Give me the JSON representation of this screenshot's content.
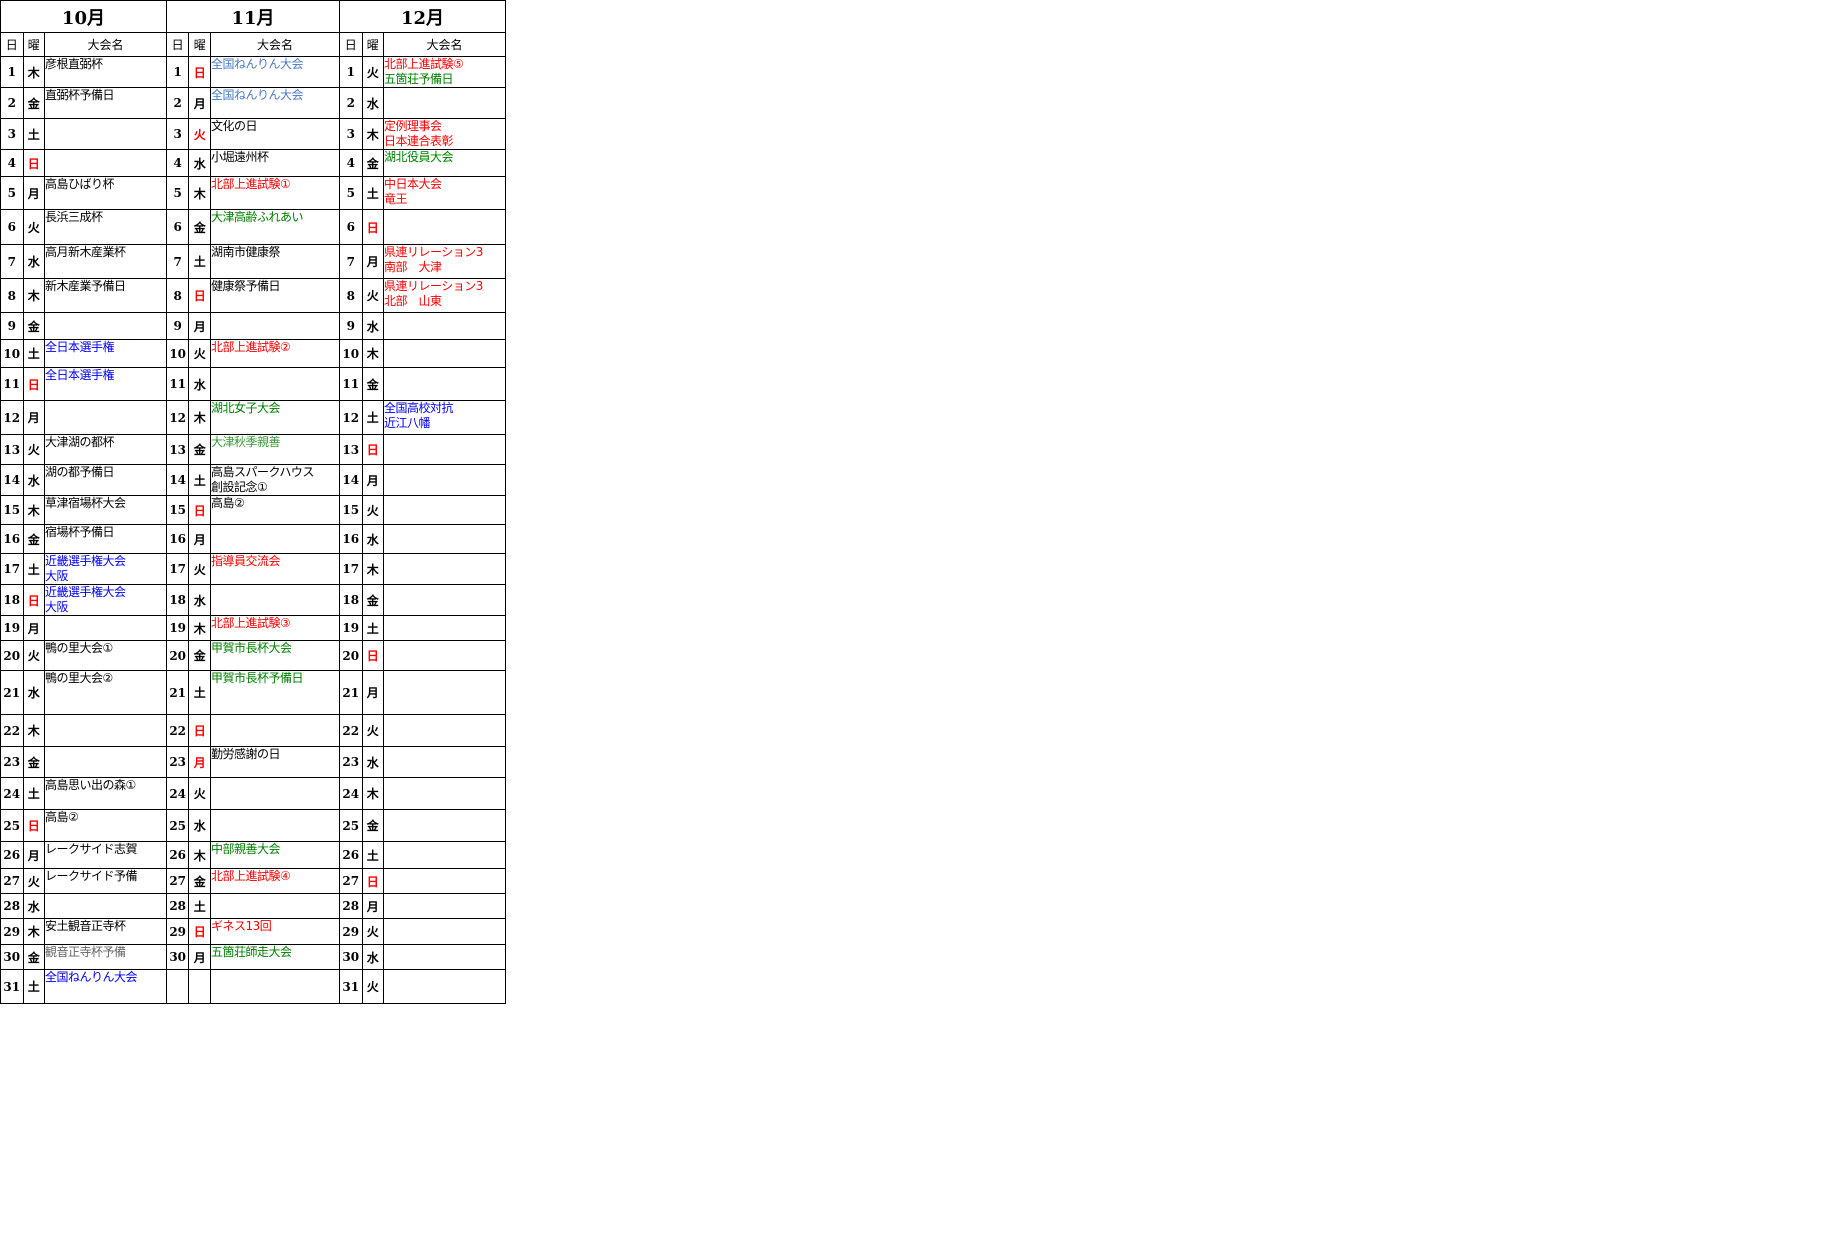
{
  "months": [
    "10月",
    "11月",
    "12月"
  ],
  "col_headers": {
    "day": "日",
    "weekday": "曜",
    "event": "大会名"
  },
  "colors": {
    "black": "#000000",
    "red": "#ff0000",
    "blue": "#0000ff",
    "green": "#008000",
    "lightblue": "#4a7cc4",
    "gray": "#666666",
    "lightgreen": "#3a9a3a"
  },
  "rows": [
    {
      "d": "1",
      "m": [
        {
          "w": "木",
          "wc": "black",
          "e": [
            "彦根直弼杯"
          ],
          "c": "black"
        },
        {
          "w": "日",
          "wc": "red",
          "e": [
            "全国ねんりん大会"
          ],
          "c": "lightblue"
        },
        {
          "w": "火",
          "wc": "black",
          "e": [
            "北部上進試験⑤",
            "五箇荘予備日"
          ],
          "c": [
            "red",
            "green"
          ]
        }
      ]
    },
    {
      "d": "2",
      "m": [
        {
          "w": "金",
          "wc": "black",
          "e": [
            "直弼杯予備日"
          ],
          "c": "black"
        },
        {
          "w": "月",
          "wc": "black",
          "e": [
            "全国ねんりん大会"
          ],
          "c": "lightblue"
        },
        {
          "w": "水",
          "wc": "black",
          "e": [],
          "c": "black"
        }
      ]
    },
    {
      "d": "3",
      "m": [
        {
          "w": "土",
          "wc": "black",
          "e": [],
          "c": "black"
        },
        {
          "w": "火",
          "wc": "red",
          "e": [
            "文化の日"
          ],
          "c": "black"
        },
        {
          "w": "木",
          "wc": "black",
          "e": [
            "定例理事会",
            "日本連合表彰"
          ],
          "c": "red"
        }
      ]
    },
    {
      "d": "4",
      "m": [
        {
          "w": "日",
          "wc": "red",
          "e": [],
          "c": "black"
        },
        {
          "w": "水",
          "wc": "black",
          "e": [
            "小堀遠州杯"
          ],
          "c": "black"
        },
        {
          "w": "金",
          "wc": "black",
          "e": [
            "湖北役員大会"
          ],
          "c": "green"
        }
      ]
    },
    {
      "d": "5",
      "m": [
        {
          "w": "月",
          "wc": "black",
          "e": [
            "高島ひばり杯"
          ],
          "c": "black"
        },
        {
          "w": "木",
          "wc": "black",
          "e": [
            "北部上進試験①"
          ],
          "c": "red"
        },
        {
          "w": "土",
          "wc": "black",
          "e": [
            "中日本大会",
            "竜王"
          ],
          "c": "red"
        }
      ]
    },
    {
      "d": "6",
      "m": [
        {
          "w": "火",
          "wc": "black",
          "e": [
            "長浜三成杯"
          ],
          "c": "black"
        },
        {
          "w": "金",
          "wc": "black",
          "e": [
            "大津高齢ふれあい"
          ],
          "c": "green"
        },
        {
          "w": "日",
          "wc": "red",
          "e": [],
          "c": "black"
        }
      ]
    },
    {
      "d": "7",
      "m": [
        {
          "w": "水",
          "wc": "black",
          "e": [
            "高月新木産業杯"
          ],
          "c": "black"
        },
        {
          "w": "土",
          "wc": "black",
          "e": [
            "湖南市健康祭"
          ],
          "c": "black"
        },
        {
          "w": "月",
          "wc": "black",
          "e": [
            "県連リレーション3",
            "南部　大津"
          ],
          "c": "red"
        }
      ]
    },
    {
      "d": "8",
      "m": [
        {
          "w": "木",
          "wc": "black",
          "e": [
            "新木産業予備日"
          ],
          "c": "black"
        },
        {
          "w": "日",
          "wc": "red",
          "e": [
            "健康祭予備日"
          ],
          "c": "black"
        },
        {
          "w": "火",
          "wc": "black",
          "e": [
            "県連リレーション3",
            "北部　山東"
          ],
          "c": "red"
        }
      ]
    },
    {
      "d": "9",
      "m": [
        {
          "w": "金",
          "wc": "black",
          "e": [],
          "c": "black"
        },
        {
          "w": "月",
          "wc": "black",
          "e": [],
          "c": "black"
        },
        {
          "w": "水",
          "wc": "black",
          "e": [],
          "c": "black"
        }
      ]
    },
    {
      "d": "10",
      "m": [
        {
          "w": "土",
          "wc": "black",
          "e": [
            "全日本選手権"
          ],
          "c": "blue"
        },
        {
          "w": "火",
          "wc": "black",
          "e": [
            "北部上進試験②"
          ],
          "c": "red"
        },
        {
          "w": "木",
          "wc": "black",
          "e": [],
          "c": "black"
        }
      ]
    },
    {
      "d": "11",
      "m": [
        {
          "w": "日",
          "wc": "red",
          "e": [
            "全日本選手権"
          ],
          "c": "blue"
        },
        {
          "w": "水",
          "wc": "black",
          "e": [],
          "c": "black"
        },
        {
          "w": "金",
          "wc": "black",
          "e": [],
          "c": "black"
        }
      ]
    },
    {
      "d": "12",
      "m": [
        {
          "w": "月",
          "wc": "black",
          "e": [],
          "c": "black"
        },
        {
          "w": "木",
          "wc": "black",
          "e": [
            "湖北女子大会"
          ],
          "c": "green"
        },
        {
          "w": "土",
          "wc": "black",
          "e": [
            "全国高校対抗",
            "近江八幡"
          ],
          "c": "blue"
        }
      ]
    },
    {
      "d": "13",
      "m": [
        {
          "w": "火",
          "wc": "black",
          "e": [
            "大津湖の都杯"
          ],
          "c": "black"
        },
        {
          "w": "金",
          "wc": "black",
          "e": [
            "大津秋季親善"
          ],
          "c": "lightgreen"
        },
        {
          "w": "日",
          "wc": "red",
          "e": [],
          "c": "black"
        }
      ]
    },
    {
      "d": "14",
      "m": [
        {
          "w": "水",
          "wc": "black",
          "e": [
            "湖の都予備日"
          ],
          "c": "black"
        },
        {
          "w": "土",
          "wc": "black",
          "e": [
            "高島スパークハウス",
            "創設記念①"
          ],
          "c": "black"
        },
        {
          "w": "月",
          "wc": "black",
          "e": [],
          "c": "black"
        }
      ]
    },
    {
      "d": "15",
      "m": [
        {
          "w": "木",
          "wc": "black",
          "e": [
            "草津宿場杯大会"
          ],
          "c": "black"
        },
        {
          "w": "日",
          "wc": "red",
          "e": [
            "高島②"
          ],
          "c": "black"
        },
        {
          "w": "火",
          "wc": "black",
          "e": [],
          "c": "black"
        }
      ]
    },
    {
      "d": "16",
      "m": [
        {
          "w": "金",
          "wc": "black",
          "e": [
            "宿場杯予備日"
          ],
          "c": "black"
        },
        {
          "w": "月",
          "wc": "black",
          "e": [],
          "c": "black"
        },
        {
          "w": "水",
          "wc": "black",
          "e": [],
          "c": "black"
        }
      ]
    },
    {
      "d": "17",
      "m": [
        {
          "w": "土",
          "wc": "black",
          "e": [
            "近畿選手権大会",
            "大阪"
          ],
          "c": "blue"
        },
        {
          "w": "火",
          "wc": "black",
          "e": [
            "指導員交流会"
          ],
          "c": "red"
        },
        {
          "w": "木",
          "wc": "black",
          "e": [],
          "c": "black"
        }
      ]
    },
    {
      "d": "18",
      "m": [
        {
          "w": "日",
          "wc": "red",
          "e": [
            "近畿選手権大会",
            "大阪"
          ],
          "c": "blue"
        },
        {
          "w": "水",
          "wc": "black",
          "e": [],
          "c": "black"
        },
        {
          "w": "金",
          "wc": "black",
          "e": [],
          "c": "black"
        }
      ]
    },
    {
      "d": "19",
      "m": [
        {
          "w": "月",
          "wc": "black",
          "e": [],
          "c": "black"
        },
        {
          "w": "木",
          "wc": "black",
          "e": [
            "北部上進試験③"
          ],
          "c": "red"
        },
        {
          "w": "土",
          "wc": "black",
          "e": [],
          "c": "black"
        }
      ]
    },
    {
      "d": "20",
      "m": [
        {
          "w": "火",
          "wc": "black",
          "e": [
            "鴨の里大会①"
          ],
          "c": "black"
        },
        {
          "w": "金",
          "wc": "black",
          "e": [
            "甲賀市長杯大会"
          ],
          "c": "green"
        },
        {
          "w": "日",
          "wc": "red",
          "e": [],
          "c": "black"
        }
      ]
    },
    {
      "d": "21",
      "m": [
        {
          "w": "水",
          "wc": "black",
          "e": [
            "鴨の里大会②"
          ],
          "c": "black"
        },
        {
          "w": "土",
          "wc": "black",
          "e": [
            "甲賀市長杯予備日"
          ],
          "c": "green"
        },
        {
          "w": "月",
          "wc": "black",
          "e": [],
          "c": "black"
        }
      ]
    },
    {
      "d": "22",
      "m": [
        {
          "w": "木",
          "wc": "black",
          "e": [],
          "c": "black"
        },
        {
          "w": "日",
          "wc": "red",
          "e": [],
          "c": "black"
        },
        {
          "w": "火",
          "wc": "black",
          "e": [],
          "c": "black"
        }
      ]
    },
    {
      "d": "23",
      "m": [
        {
          "w": "金",
          "wc": "black",
          "e": [],
          "c": "black"
        },
        {
          "w": "月",
          "wc": "red",
          "e": [
            "勤労感謝の日"
          ],
          "c": "black"
        },
        {
          "w": "水",
          "wc": "black",
          "e": [],
          "c": "black"
        }
      ]
    },
    {
      "d": "24",
      "m": [
        {
          "w": "土",
          "wc": "black",
          "e": [
            "高島思い出の森①"
          ],
          "c": "black"
        },
        {
          "w": "火",
          "wc": "black",
          "e": [],
          "c": "black"
        },
        {
          "w": "木",
          "wc": "black",
          "e": [],
          "c": "black"
        }
      ]
    },
    {
      "d": "25",
      "m": [
        {
          "w": "日",
          "wc": "red",
          "e": [
            "高島②"
          ],
          "c": "black"
        },
        {
          "w": "水",
          "wc": "black",
          "e": [],
          "c": "black"
        },
        {
          "w": "金",
          "wc": "black",
          "e": [],
          "c": "black"
        }
      ]
    },
    {
      "d": "26",
      "m": [
        {
          "w": "月",
          "wc": "black",
          "e": [
            "レークサイド志賀"
          ],
          "c": "black"
        },
        {
          "w": "木",
          "wc": "black",
          "e": [
            "中部親善大会"
          ],
          "c": "green"
        },
        {
          "w": "土",
          "wc": "black",
          "e": [],
          "c": "black"
        }
      ]
    },
    {
      "d": "27",
      "m": [
        {
          "w": "火",
          "wc": "black",
          "e": [
            "レークサイド予備"
          ],
          "c": "black"
        },
        {
          "w": "金",
          "wc": "black",
          "e": [
            "北部上進試験④"
          ],
          "c": "red"
        },
        {
          "w": "日",
          "wc": "red",
          "e": [],
          "c": "black"
        }
      ]
    },
    {
      "d": "28",
      "m": [
        {
          "w": "水",
          "wc": "black",
          "e": [],
          "c": "black"
        },
        {
          "w": "土",
          "wc": "black",
          "e": [],
          "c": "black"
        },
        {
          "w": "月",
          "wc": "black",
          "e": [],
          "c": "black"
        }
      ]
    },
    {
      "d": "29",
      "m": [
        {
          "w": "木",
          "wc": "black",
          "e": [
            "安土観音正寺杯"
          ],
          "c": "black"
        },
        {
          "w": "日",
          "wc": "red",
          "e": [
            "ギネス13回"
          ],
          "c": "red"
        },
        {
          "w": "火",
          "wc": "black",
          "e": [],
          "c": "black"
        }
      ]
    },
    {
      "d": "30",
      "m": [
        {
          "w": "金",
          "wc": "black",
          "e": [
            "観音正寺杯予備"
          ],
          "c": "gray"
        },
        {
          "w": "月",
          "wc": "black",
          "e": [
            "五箇荘師走大会"
          ],
          "c": "green"
        },
        {
          "w": "水",
          "wc": "black",
          "e": [],
          "c": "black"
        }
      ]
    },
    {
      "d": "31",
      "m": [
        {
          "w": "土",
          "wc": "black",
          "e": [
            "全国ねんりん大会"
          ],
          "c": "blue"
        },
        null,
        {
          "w": "火",
          "wc": "black",
          "e": [],
          "c": "black"
        }
      ]
    }
  ]
}
